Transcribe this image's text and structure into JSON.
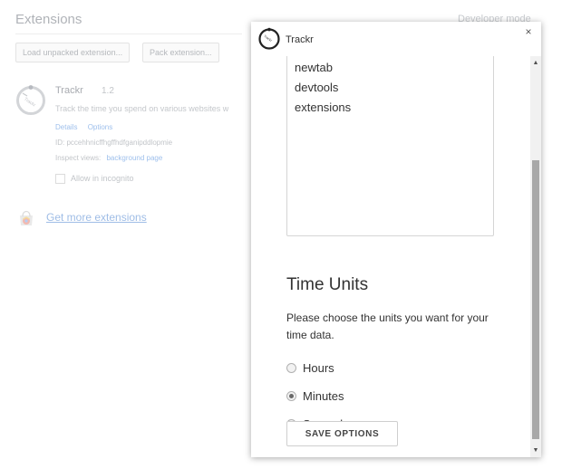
{
  "background": {
    "page_title": "Extensions",
    "developer_mode_label": "Developer mode",
    "buttons": {
      "load_unpacked": "Load unpacked extension...",
      "pack": "Pack extension..."
    },
    "extension": {
      "name": "Trackr",
      "version": "1.2",
      "description": "Track the time you spend on various websites w",
      "details_link": "Details",
      "options_link": "Options",
      "id_text": "ID: pccehhnicffhgffhdfganipddlopmie",
      "inspect_label": "Inspect views:",
      "inspect_link": "background page",
      "incognito_label": "Allow in incognito"
    },
    "get_more_link": "Get more extensions"
  },
  "dialog": {
    "title": "Trackr",
    "close_glyph": "×",
    "site_list": [
      "newtab",
      "devtools",
      "extensions"
    ],
    "time_units": {
      "heading": "Time Units",
      "description": "Please choose the units you want for your time data.",
      "options": [
        {
          "label": "Hours",
          "checked": false
        },
        {
          "label": "Minutes",
          "checked": true
        },
        {
          "label": "Seconds",
          "checked": false
        }
      ],
      "save_label": "SAVE OPTIONS"
    },
    "scrollbar": {
      "up_glyph": "▲",
      "down_glyph": "▼"
    }
  },
  "icons": {
    "trackr_logo": "stopwatch-logo-icon",
    "webstore": "chrome-web-store-icon",
    "close": "close-icon",
    "scroll_up": "scroll-up-arrow-icon",
    "scroll_down": "scroll-down-arrow-icon"
  },
  "colors": {
    "link_faded": "#9fc0ec",
    "text_dark": "#333333",
    "scroll_thumb": "#a8a8a8"
  }
}
